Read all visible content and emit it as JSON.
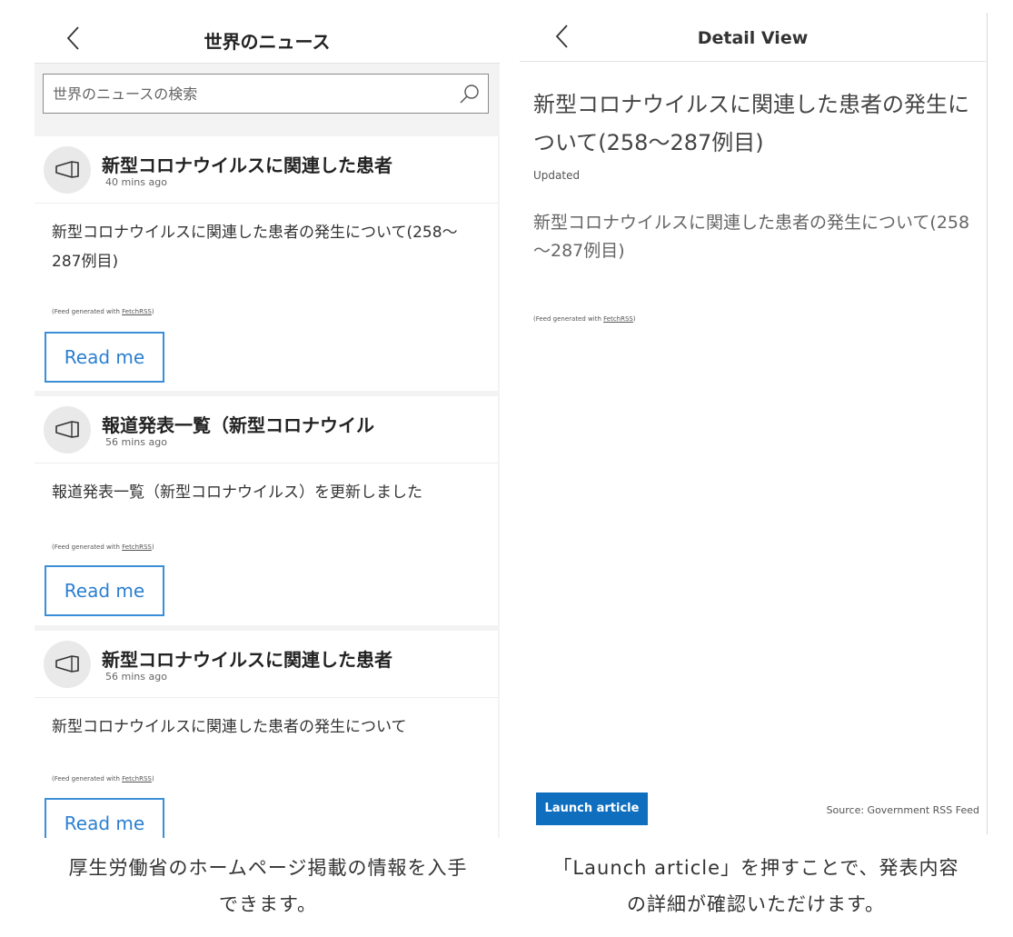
{
  "left": {
    "title": "世界のニュース",
    "search": {
      "placeholder": "世界のニュースの検索"
    },
    "cards": [
      {
        "title": "新型コロナウイルスに関連した患者",
        "time": "40 mins ago",
        "body": "新型コロナウイルスに関連した患者の発生について(258～287例目)",
        "feed_prefix": "(Feed generated with ",
        "feed_link": "FetchRSS",
        "feed_suffix": ")",
        "button": "Read me"
      },
      {
        "title": "報道発表一覧（新型コロナウイル",
        "time": "56 mins ago",
        "body": "報道発表一覧（新型コロナウイルス）を更新しました",
        "feed_prefix": "(Feed generated with ",
        "feed_link": "FetchRSS",
        "feed_suffix": ")",
        "button": "Read me"
      },
      {
        "title": "新型コロナウイルスに関連した患者",
        "time": "56 mins ago",
        "body": "新型コロナウイルスに関連した患者の発生について",
        "feed_prefix": "(Feed generated with ",
        "feed_link": "FetchRSS",
        "feed_suffix": ")",
        "button": "Read me"
      }
    ]
  },
  "right": {
    "title": "Detail View",
    "article_title": "新型コロナウイルスに関連した患者の発生について(258～287例目)",
    "updated": "Updated",
    "body": "新型コロナウイルスに関連した患者の発生について(258～287例目)",
    "feed_prefix": "(Feed generated with ",
    "feed_link": "FetchRSS",
    "feed_suffix": ")",
    "launch_button": "Launch article",
    "source": "Source: Government RSS Feed"
  },
  "captions": {
    "left_line1": "厚生労働省のホームページ掲載の情報を入手",
    "left_line2": "できます。",
    "right_line1": "「Launch article」を押すことで、発表内容",
    "right_line2": "の詳細が確認いただけます。"
  },
  "colors": {
    "accent_blue": "#106ebe",
    "read_button_border": "#3a8fd8",
    "panel_bg": "#f3f3f3"
  },
  "icons": [
    "chevron-left-icon",
    "search-icon",
    "megaphone-icon"
  ]
}
